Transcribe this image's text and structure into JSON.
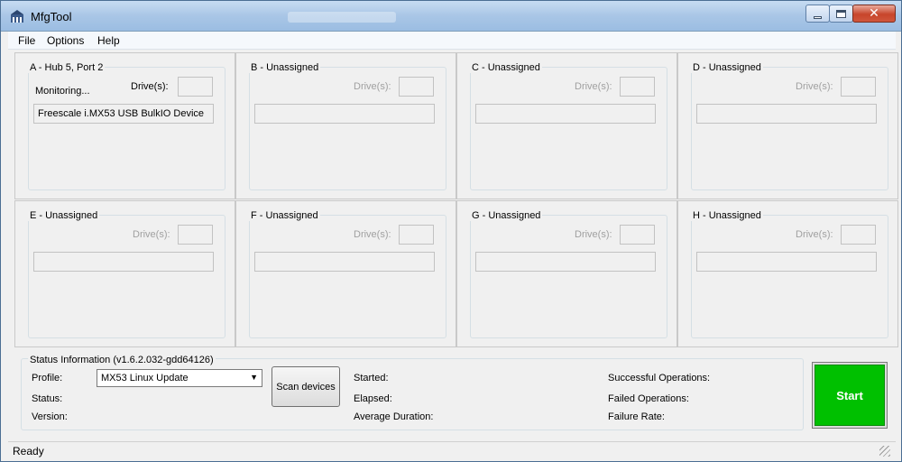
{
  "window": {
    "title": "MfgTool"
  },
  "menu": {
    "items": [
      "File",
      "Options",
      "Help"
    ]
  },
  "panels": [
    {
      "title": "A - Hub 5, Port 2",
      "drives_label": "Drive(s):",
      "status": "Monitoring...",
      "device": "Freescale i.MX53 USB BulkIO Device",
      "active": true
    },
    {
      "title": "B - Unassigned",
      "drives_label": "Drive(s):",
      "device": "",
      "active": false
    },
    {
      "title": "C - Unassigned",
      "drives_label": "Drive(s):",
      "device": "",
      "active": false
    },
    {
      "title": "D - Unassigned",
      "drives_label": "Drive(s):",
      "device": "",
      "active": false
    },
    {
      "title": "E - Unassigned",
      "drives_label": "Drive(s):",
      "device": "",
      "active": false
    },
    {
      "title": "F - Unassigned",
      "drives_label": "Drive(s):",
      "device": "",
      "active": false
    },
    {
      "title": "G - Unassigned",
      "drives_label": "Drive(s):",
      "device": "",
      "active": false
    },
    {
      "title": "H - Unassigned",
      "drives_label": "Drive(s):",
      "device": "",
      "active": false
    }
  ],
  "status": {
    "title": "Status Information (v1.6.2.032-gdd64126)",
    "profile_label": "Profile:",
    "profile_value": "MX53 Linux Update",
    "status_label": "Status:",
    "version_label": "Version:",
    "scan_button": "Scan devices",
    "started_label": "Started:",
    "elapsed_label": "Elapsed:",
    "avg_duration_label": "Average Duration:",
    "successful_label": "Successful Operations:",
    "failed_label": "Failed Operations:",
    "failure_rate_label": "Failure Rate:",
    "start_button": "Start",
    "start_color": "#00c000"
  },
  "statusbar": {
    "text": "Ready"
  }
}
